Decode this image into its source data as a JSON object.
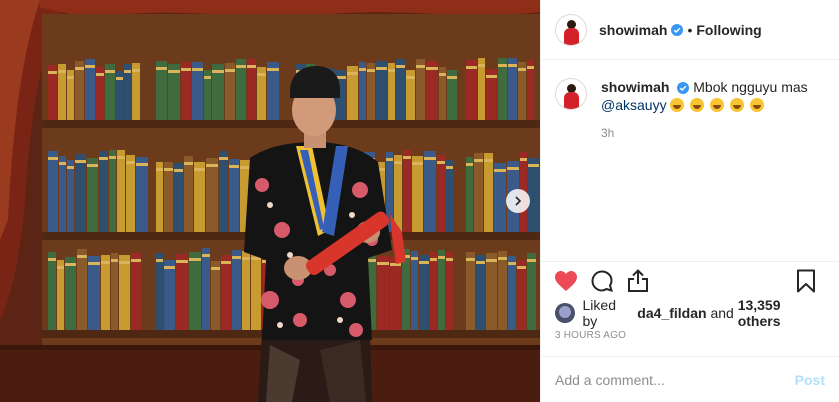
{
  "photo": {
    "alt_subject": "graduation-photo",
    "colors": {
      "curtain": "#7a2416",
      "shelf": "#6b3b1c",
      "book_red": "#9c2a24",
      "book_green": "#3f6b3e",
      "book_blue": "#3a5a8a",
      "book_yellow": "#c79b2f"
    }
  },
  "header": {
    "username": "showimah",
    "separator": "•",
    "follow_status": "Following"
  },
  "caption": {
    "username": "showimah",
    "text": "Mbok ngguyu mas",
    "mention": "@aksauyy",
    "timestamp": "3h"
  },
  "actions": {
    "like_icon": "heart-filled-icon",
    "comment_icon": "comment-icon",
    "share_icon": "share-icon",
    "save_icon": "bookmark-icon",
    "like_color": "#ed4956"
  },
  "likes": {
    "prefix": "Liked by",
    "user": "da4_fildan",
    "joiner": "and",
    "others": "13,359 others"
  },
  "posted": "3 HOURS AGO",
  "comment_box": {
    "placeholder": "Add a comment...",
    "post_label": "Post",
    "post_color": "#b2dffc"
  }
}
